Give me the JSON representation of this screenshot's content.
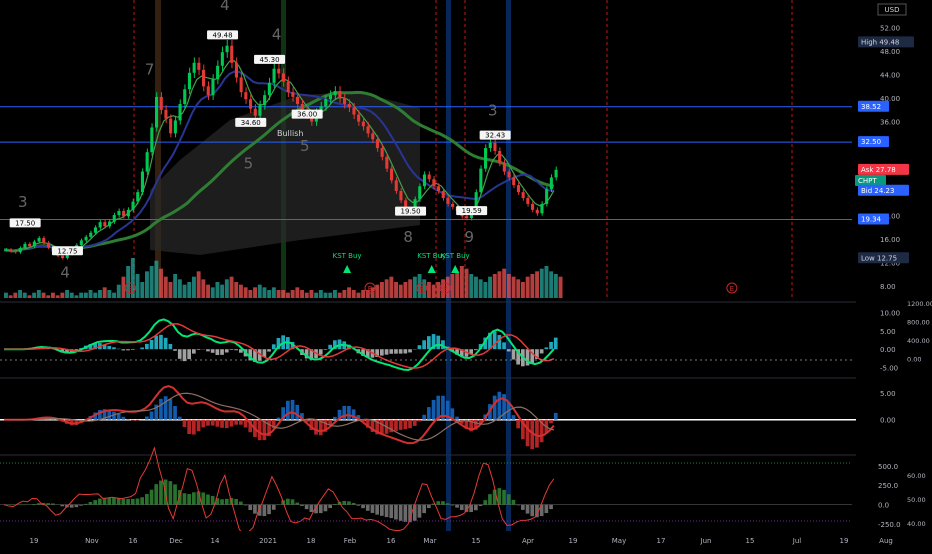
{
  "currency": "USD",
  "price_axis": {
    "ticks": [
      "52.00",
      "48.00",
      "44.00",
      "40.00",
      "36.00",
      "28.00",
      "20.00",
      "16.00",
      "12.00",
      "8.00"
    ],
    "tick_values": [
      52,
      48,
      44,
      40,
      36,
      28,
      20,
      16,
      12,
      8
    ],
    "min": 6,
    "max": 56
  },
  "price_tags": [
    {
      "label": "High",
      "value": "49.48",
      "v": 49.48,
      "color": "#1e2a44",
      "text": "#d1d4dc"
    },
    {
      "label": "",
      "value": "38.52",
      "v": 38.52,
      "color": "#2962ff",
      "text": "#ffffff"
    },
    {
      "label": "",
      "value": "32.50",
      "v": 32.5,
      "color": "#2962ff",
      "text": "#ffffff"
    },
    {
      "label": "Ask",
      "value": "27.78",
      "v": 27.78,
      "color": "#f23645",
      "text": "#ffffff"
    },
    {
      "label": "CHPT",
      "value": "",
      "v": 25.9,
      "color": "#089981",
      "text": "#ffffff"
    },
    {
      "label": "Bid",
      "value": "24.23",
      "v": 24.23,
      "color": "#2962ff",
      "text": "#ffffff"
    },
    {
      "label": "",
      "value": "19.34",
      "v": 19.34,
      "color": "#2962ff",
      "text": "#ffffff"
    },
    {
      "label": "Low",
      "value": "12.75",
      "v": 12.75,
      "color": "#1e2a44",
      "text": "#d1d4dc"
    }
  ],
  "chart_data": {
    "type": "line",
    "symbol": "CHPT",
    "x_ticks": [
      "19",
      "Nov",
      "16",
      "Dec",
      "14",
      "2021",
      "18",
      "Feb",
      "16",
      "Mar",
      "15",
      "Apr",
      "19",
      "May",
      "17",
      "Jun",
      "15",
      "Jul",
      "19",
      "Aug"
    ],
    "horizontal_levels": [
      38.52,
      32.5,
      19.34
    ],
    "close": [
      14.2,
      14.0,
      13.8,
      14.5,
      15.2,
      14.8,
      15.6,
      16.2,
      15.4,
      14.6,
      13.9,
      13.2,
      12.8,
      13.5,
      14.2,
      15.0,
      15.8,
      16.4,
      17.1,
      18.0,
      18.9,
      18.2,
      19.0,
      20.1,
      20.8,
      19.9,
      21.0,
      22.4,
      24.0,
      27.5,
      30.8,
      35.0,
      40.2,
      38.0,
      36.5,
      34.0,
      36.2,
      39.0,
      41.5,
      44.3,
      46.0,
      44.8,
      42.0,
      40.5,
      43.2,
      45.5,
      47.8,
      48.9,
      46.0,
      43.5,
      41.0,
      39.8,
      38.2,
      37.0,
      38.8,
      40.5,
      42.6,
      45.0,
      44.2,
      42.8,
      41.0,
      40.2,
      39.0,
      38.0,
      37.2,
      36.0,
      37.5,
      38.6,
      39.8,
      40.5,
      41.2,
      40.0,
      39.0,
      38.4,
      37.2,
      36.0,
      35.2,
      34.0,
      33.0,
      31.5,
      30.0,
      28.0,
      26.0,
      24.2,
      22.6,
      21.0,
      20.5,
      22.8,
      25.0,
      27.0,
      26.2,
      25.0,
      24.2,
      23.0,
      22.0,
      21.5,
      20.8,
      19.9,
      19.6,
      21.0,
      24.0,
      28.0,
      31.5,
      32.4,
      31.0,
      29.0,
      27.5,
      26.5,
      25.2,
      24.0,
      23.0,
      22.0,
      21.0,
      20.4,
      22.0,
      24.5,
      26.5,
      27.8
    ],
    "annotations": [
      {
        "text": "17.50",
        "i": 4,
        "v": 17.5
      },
      {
        "text": "12.75",
        "i": 13,
        "v": 12.75
      },
      {
        "text": "49.48",
        "i": 46,
        "v": 49.48
      },
      {
        "text": "45.30",
        "i": 56,
        "v": 45.3
      },
      {
        "text": "34.60",
        "i": 52,
        "v": 34.6
      },
      {
        "text": "36.00",
        "i": 64,
        "v": 36.0
      },
      {
        "text": "19.50",
        "i": 86,
        "v": 19.5
      },
      {
        "text": "19.59",
        "i": 99,
        "v": 19.59
      },
      {
        "text": "32.43",
        "i": 104,
        "v": 32.43
      }
    ],
    "wave_counts": [
      {
        "text": "3",
        "i": 4,
        "v": 21.5
      },
      {
        "text": "4",
        "i": 13,
        "v": 9.5
      },
      {
        "text": "7",
        "i": 31,
        "v": 44.0
      },
      {
        "text": "4",
        "i": 47,
        "v": 55.0
      },
      {
        "text": "4",
        "i": 58,
        "v": 50.0
      },
      {
        "text": "5",
        "i": 52,
        "v": 28.0
      },
      {
        "text": "5",
        "i": 64,
        "v": 31.0
      },
      {
        "text": "8",
        "i": 86,
        "v": 15.5
      },
      {
        "text": "9",
        "i": 99,
        "v": 15.5
      },
      {
        "text": "3",
        "i": 104,
        "v": 37.0
      }
    ],
    "signals": [
      {
        "text": "KST Buy",
        "i": 73
      },
      {
        "text": "KST Buy",
        "i": 91
      },
      {
        "text": "KST Buy",
        "i": 96
      }
    ],
    "bullish_text": "Bullish",
    "earnings_markers": [
      19,
      70,
      81,
      86,
      147
    ],
    "earnings_label": "E",
    "volume": [
      2,
      1,
      2,
      3,
      2,
      1,
      2,
      3,
      2,
      1,
      2,
      1,
      2,
      3,
      2,
      1,
      2,
      2,
      3,
      2,
      3,
      4,
      3,
      2,
      5,
      8,
      12,
      15,
      9,
      6,
      10,
      12,
      14,
      11,
      8,
      6,
      9,
      7,
      5,
      6,
      8,
      10,
      7,
      5,
      4,
      6,
      5,
      7,
      8,
      6,
      5,
      4,
      3,
      4,
      5,
      4,
      3,
      4,
      3,
      3,
      2,
      3,
      4,
      3,
      2,
      3,
      2,
      3,
      2,
      2,
      3,
      2,
      3,
      4,
      3,
      2,
      3,
      3,
      4,
      5,
      6,
      7,
      8,
      6,
      5,
      6,
      7,
      8,
      9,
      7,
      6,
      5,
      6,
      7,
      8,
      9,
      10,
      12,
      11,
      9,
      8,
      7,
      6,
      8,
      9,
      10,
      11,
      9,
      8,
      7,
      6,
      8,
      9,
      10,
      11,
      12,
      10,
      9,
      8
    ]
  },
  "macd_panel": {
    "ticks": [
      "10.00",
      "5.00",
      "0.00",
      "-5.00"
    ],
    "right_ticks": [
      "1200.00",
      "800.00",
      "400.00",
      "0.00"
    ]
  },
  "kst_panel": {
    "ticks": [
      "5.00",
      "0.00"
    ]
  },
  "rsi_panel": {
    "ticks": [
      "500.0",
      "250.0",
      "0.0",
      "-250.0"
    ],
    "right_ticks": [
      "60.00",
      "50.00",
      "40.00"
    ]
  },
  "colors": {
    "bull": "#26a69a",
    "bear": "#ef5350",
    "green_bright": "#00e676",
    "ma_blue": "#1e3a8a",
    "ma_green": "#1b5e20",
    "level_line": "#2962ff",
    "dashed_red": "#b71c1c"
  }
}
